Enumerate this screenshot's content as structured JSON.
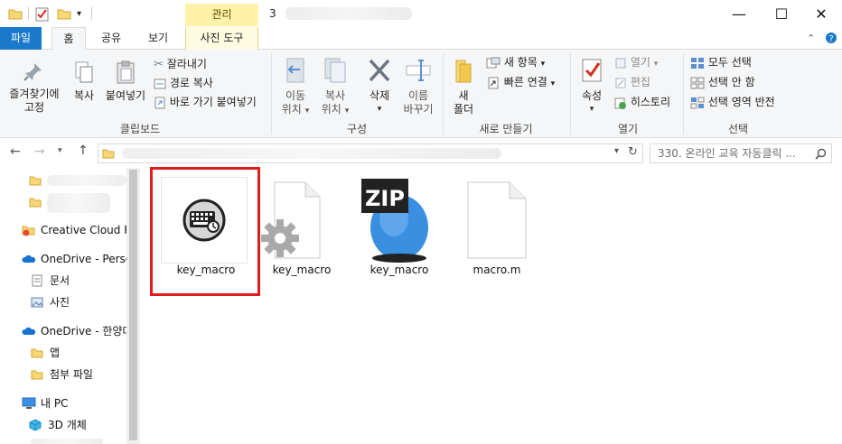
{
  "titlebar": {
    "context_tab": "관리",
    "title_prefix": "3",
    "minimize": "—",
    "maximize": "☐",
    "close": "✕"
  },
  "tabs": {
    "file": "파일",
    "home": "홈",
    "share": "공유",
    "view": "보기",
    "picture_tools": "사진 도구"
  },
  "ribbon": {
    "clipboard": {
      "pin_label_1": "즐겨찾기에",
      "pin_label_2": "고정",
      "copy": "복사",
      "paste": "붙여넣기",
      "cut": "잘라내기",
      "copy_path": "경로 복사",
      "paste_shortcut": "바로 가기 붙여넣기",
      "group": "클립보드"
    },
    "organize": {
      "move_1": "이동",
      "move_2": "위치",
      "copyto_1": "복사",
      "copyto_2": "위치",
      "delete": "삭제",
      "rename_1": "이름",
      "rename_2": "바꾸기",
      "group": "구성"
    },
    "new": {
      "new_folder_1": "새",
      "new_folder_2": "폴더",
      "new_item": "새 항목",
      "easy_access": "빠른 연결",
      "group": "새로 만들기"
    },
    "open": {
      "properties": "속성",
      "open": "열기",
      "edit": "편집",
      "history": "히스토리",
      "group": "열기"
    },
    "select": {
      "select_all": "모두 선택",
      "select_none": "선택 안 함",
      "invert": "선택 영역 반전",
      "group": "선택"
    }
  },
  "address": {
    "search_placeholder": "330. 온라인 교육 자동클릭 ..."
  },
  "nav": {
    "items": [
      {
        "label": "Creative Cloud Fil"
      },
      {
        "label": "OneDrive - Persor"
      },
      {
        "label": "문서"
      },
      {
        "label": "사진"
      },
      {
        "label": "OneDrive - 한양대"
      },
      {
        "label": "앱"
      },
      {
        "label": "첨부 파일"
      },
      {
        "label": "내 PC"
      },
      {
        "label": "3D 개체"
      }
    ]
  },
  "files": [
    {
      "name": "key_macro",
      "icon": "keyboard-app-icon"
    },
    {
      "name": "key_macro",
      "icon": "settings-file-icon"
    },
    {
      "name": "key_macro",
      "icon": "zip-archive-icon"
    },
    {
      "name": "macro.m",
      "icon": "blank-file-icon"
    }
  ],
  "colors": {
    "file_tab": "#1979ca",
    "context_tab": "#fff2a8",
    "selection_highlight": "#e01b1b"
  }
}
